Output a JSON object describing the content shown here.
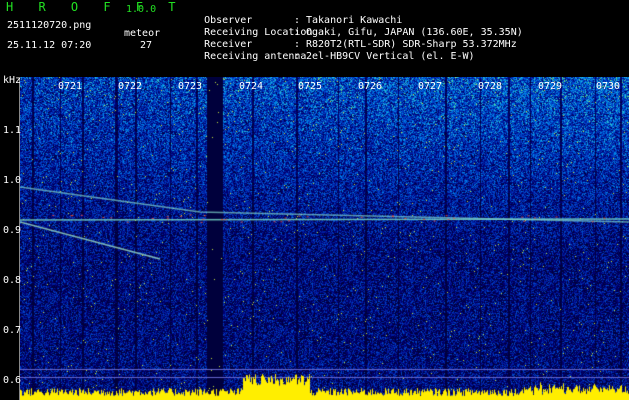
{
  "app": {
    "title": "H R O F F T",
    "version": "1.0.0"
  },
  "file_name": "2511120720.png",
  "timestamp": "25.11.12 07:20",
  "meteor": {
    "label": "meteor",
    "count": "27"
  },
  "info": [
    {
      "label": "Observer",
      "sep": ":",
      "value": "Takanori Kawachi"
    },
    {
      "label": "Receiving Location",
      "sep": ":",
      "value": "Ogaki, Gifu, JAPAN (136.60E, 35.35N)"
    },
    {
      "label": "Receiver",
      "sep": ":",
      "value": "R820T2(RTL-SDR) SDR-Sharp 53.372MHz"
    },
    {
      "label": "Receiving antenna",
      "sep": ":",
      "value": "2el-HB9CV Vertical (el. E-W)"
    }
  ],
  "y_axis": {
    "unit": "kHz",
    "ticks": [
      "1.1",
      "1.0",
      "0.9",
      "0.8",
      "0.7",
      "0.6"
    ]
  },
  "x_axis": {
    "ticks": [
      "0721",
      "0722",
      "0723",
      "0724",
      "0725",
      "0726",
      "0727",
      "0728",
      "0729",
      "0730"
    ]
  },
  "colors": {
    "header_green": "#22e022",
    "text_white": "#ffffff",
    "background": "#000000",
    "amplitude_bar": "#ffee00"
  }
}
